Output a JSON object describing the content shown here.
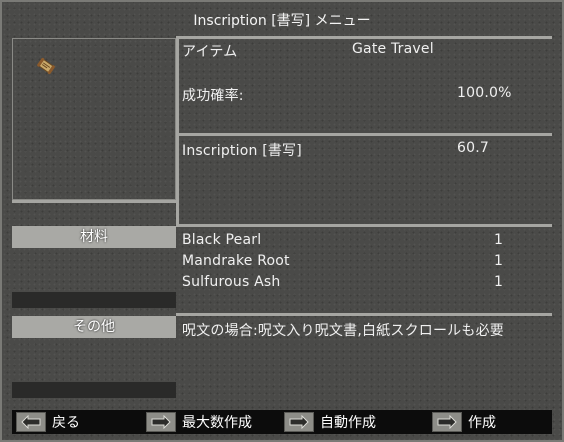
{
  "title": "Inscription [書写] メニュー",
  "item": {
    "label": "アイテム",
    "name": "Gate Travel",
    "icon": "scroll-icon"
  },
  "success": {
    "label": "成功確率:",
    "value": "100.0%"
  },
  "skill": {
    "label": "Inscription [書写]",
    "value": "60.7"
  },
  "materials": {
    "header": "材料",
    "rows": [
      {
        "name": "Black Pearl",
        "qty": "1"
      },
      {
        "name": "Mandrake Root",
        "qty": "1"
      },
      {
        "name": "Sulfurous Ash",
        "qty": "1"
      }
    ]
  },
  "other": {
    "header": "その他",
    "note": "呪文の場合:呪文入り呪文書,白紙スクロールも必要"
  },
  "buttons": {
    "back": "戻る",
    "make_max": "最大数作成",
    "auto": "自動作成",
    "make": "作成"
  }
}
